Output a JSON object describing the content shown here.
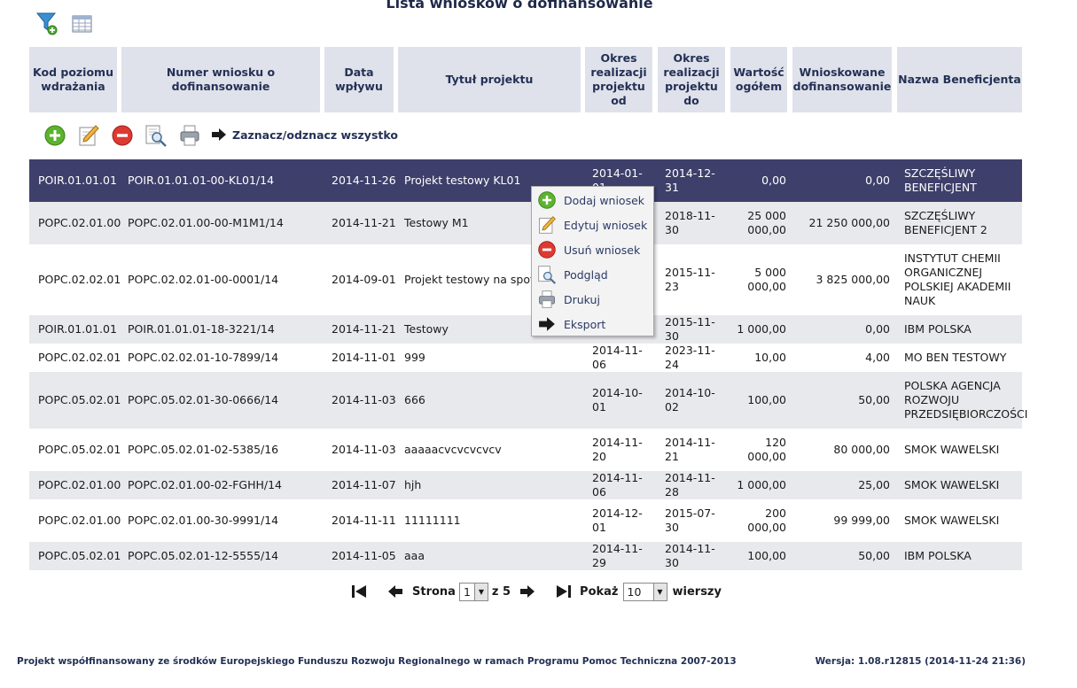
{
  "title": "Lista wniosków o dofinansowanie",
  "columns": [
    "Kod poziomu wdrażania",
    "Numer wniosku o dofinansowanie",
    "Data wpływu",
    "Tytuł projektu",
    "Okres realizacji projektu od",
    "Okres realizacji projektu do",
    "Wartość ogółem",
    "Wnioskowane dofinansowanie",
    "Nazwa Beneficjenta"
  ],
  "toolbar": {
    "select_all_label": "Zaznacz/odznacz wszystko",
    "icons": [
      "add-icon",
      "edit-icon",
      "delete-icon",
      "preview-icon",
      "print-icon"
    ]
  },
  "rows": [
    {
      "kod": "POIR.01.01.01",
      "numer": "POIR.01.01.01-00-KL01/14",
      "data": "2014-11-26",
      "tytul": "Projekt testowy KL01",
      "od": "2014-01-01",
      "do": "2014-12-31",
      "wartosc": "0,00",
      "dofin": "0,00",
      "benef": "SZCZĘŚLIWY BENEFICJENT",
      "selected": true
    },
    {
      "kod": "POPC.02.01.00",
      "numer": "POPC.02.01.00-00-M1M1/14",
      "data": "2014-11-21",
      "tytul": "Testowy M1",
      "od": "",
      "do": "2018-11-30",
      "wartosc": "25 000 000,00",
      "dofin": "21 250 000,00",
      "benef": "SZCZĘŚLIWY BENEFICJENT 2"
    },
    {
      "kod": "POPC.02.02.01",
      "numer": "POPC.02.02.01-00-0001/14",
      "data": "2014-09-01",
      "tytul": "Projekt testowy na spotka",
      "od": "",
      "do": "2015-11-23",
      "wartosc": "5 000 000,00",
      "dofin": "3 825 000,00",
      "benef": "INSTYTUT CHEMII ORGANICZNEJ POLSKIEJ AKADEMII NAUK"
    },
    {
      "kod": "POIR.01.01.01",
      "numer": "POIR.01.01.01-18-3221/14",
      "data": "2014-11-21",
      "tytul": "Testowy",
      "od": "",
      "do": "2015-11-30",
      "wartosc": "1 000,00",
      "dofin": "0,00",
      "benef": "IBM POLSKA"
    },
    {
      "kod": "POPC.02.02.01",
      "numer": "POPC.02.02.01-10-7899/14",
      "data": "2014-11-01",
      "tytul": "999",
      "od": "2014-11-06",
      "do": "2023-11-24",
      "wartosc": "10,00",
      "dofin": "4,00",
      "benef": "MO BEN TESTOWY"
    },
    {
      "kod": "POPC.05.02.01",
      "numer": "POPC.05.02.01-30-0666/14",
      "data": "2014-11-03",
      "tytul": "666",
      "od": "2014-10-01",
      "do": "2014-10-02",
      "wartosc": "100,00",
      "dofin": "50,00",
      "benef": "POLSKA AGENCJA ROZWOJU PRZEDSIĘBIORCZOŚCI"
    },
    {
      "kod": "POPC.05.02.01",
      "numer": "POPC.05.02.01-02-5385/16",
      "data": "2014-11-03",
      "tytul": "aaaaacvcvcvcvcv",
      "od": "2014-11-20",
      "do": "2014-11-21",
      "wartosc": "120 000,00",
      "dofin": "80 000,00",
      "benef": "SMOK WAWELSKI"
    },
    {
      "kod": "POPC.02.01.00",
      "numer": "POPC.02.01.00-02-FGHH/14",
      "data": "2014-11-07",
      "tytul": "hjh",
      "od": "2014-11-06",
      "do": "2014-11-28",
      "wartosc": "1 000,00",
      "dofin": "25,00",
      "benef": "SMOK WAWELSKI"
    },
    {
      "kod": "POPC.02.01.00",
      "numer": "POPC.02.01.00-30-9991/14",
      "data": "2014-11-11",
      "tytul": "11111111",
      "od": "2014-12-01",
      "do": "2015-07-30",
      "wartosc": "200 000,00",
      "dofin": "99 999,00",
      "benef": "SMOK WAWELSKI"
    },
    {
      "kod": "POPC.05.02.01",
      "numer": "POPC.05.02.01-12-5555/14",
      "data": "2014-11-05",
      "tytul": "aaa",
      "od": "2014-11-29",
      "do": "2014-11-30",
      "wartosc": "100,00",
      "dofin": "50,00",
      "benef": "IBM POLSKA"
    }
  ],
  "context_menu": [
    {
      "label": "Dodaj wniosek",
      "icon": "add-icon"
    },
    {
      "label": "Edytuj wniosek",
      "icon": "edit-icon"
    },
    {
      "label": "Usuń wniosek",
      "icon": "delete-icon"
    },
    {
      "label": "Podgląd",
      "icon": "preview-icon"
    },
    {
      "label": "Drukuj",
      "icon": "print-icon"
    },
    {
      "label": "Eksport",
      "icon": "export-arrow-icon"
    }
  ],
  "pager": {
    "page_label": "Strona",
    "page_value": "1",
    "of_label": "z 5",
    "show_label": "Pokaż",
    "rows_value": "10",
    "rows_label": "wierszy"
  },
  "footer": {
    "left": "Projekt współfinansowany ze środków Europejskiego Funduszu Rozwoju Regionalnego w ramach Programu Pomoc Techniczna 2007-2013",
    "right": "Wersja: 1.08.r12815 (2014-11-24 21:36)"
  },
  "colors": {
    "header_bg": "#dfe2ea",
    "selected_row": "#3e3f6a",
    "alt_row": "#e8e9ec",
    "accent_text": "#243056"
  }
}
